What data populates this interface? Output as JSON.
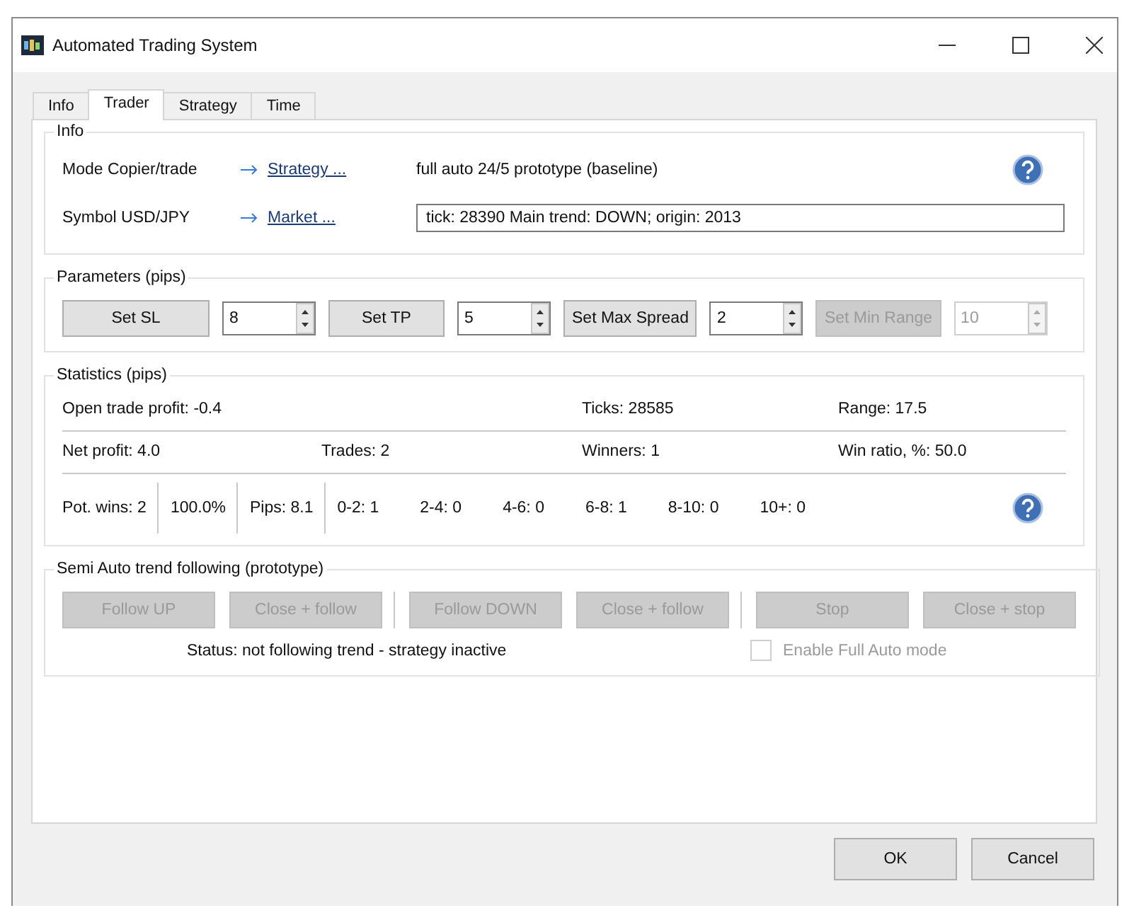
{
  "window": {
    "title": "Automated Trading System"
  },
  "tabs": [
    {
      "label": "Info",
      "selected": false
    },
    {
      "label": "Trader",
      "selected": true
    },
    {
      "label": "Strategy",
      "selected": false
    },
    {
      "label": "Time",
      "selected": false
    }
  ],
  "info": {
    "title": "Info",
    "rows": [
      {
        "label": "Mode Copier/trade",
        "link": "Strategy ...",
        "kind": "text",
        "value": "full auto 24/5 prototype (baseline)",
        "help": true
      },
      {
        "label": "Symbol USD/JPY",
        "link": "Market ...",
        "kind": "field",
        "value": "tick: 28390   Main trend: DOWN; origin: 2013",
        "help": false
      }
    ]
  },
  "parameters": {
    "title": "Parameters (pips)",
    "controls": [
      {
        "button": "Set SL",
        "value": "8",
        "disabled": false
      },
      {
        "button": "Set TP",
        "value": "5",
        "disabled": false
      },
      {
        "button": "Set Max Spread",
        "value": "2",
        "disabled": false
      },
      {
        "button": "Set Min Range",
        "value": "10",
        "disabled": true
      }
    ]
  },
  "statistics": {
    "title": "Statistics (pips)",
    "rows": [
      [
        "Open trade profit: -0.4",
        "",
        "Ticks: 28585",
        "Range: 17.5"
      ],
      [
        "Net profit: 4.0",
        "Trades: 2",
        "Winners: 1",
        "Win ratio, %: 50.0"
      ]
    ],
    "breakdown": [
      [
        "Pot. wins: 2"
      ],
      [
        "100.0%"
      ],
      [
        "Pips: 8.1"
      ],
      [
        "0-2: 1",
        "2-4: 0",
        "4-6: 0",
        "6-8: 1",
        "8-10: 0",
        "10+: 0"
      ]
    ]
  },
  "semi_auto": {
    "title": "Semi Auto trend following (prototype)",
    "button_groups": [
      [
        {
          "label": "Follow UP",
          "disabled": true
        },
        {
          "label": "Close + follow",
          "disabled": true
        }
      ],
      [
        {
          "label": "Follow DOWN",
          "disabled": true
        },
        {
          "label": "Close + follow",
          "disabled": true
        }
      ],
      [
        {
          "label": "Stop",
          "disabled": true
        },
        {
          "label": "Close + stop",
          "disabled": true
        }
      ]
    ],
    "status": "Status: not following trend - strategy inactive",
    "checkbox": {
      "label": "Enable Full Auto mode",
      "checked": false,
      "disabled": true
    }
  },
  "footer_buttons": [
    "OK",
    "Cancel"
  ]
}
